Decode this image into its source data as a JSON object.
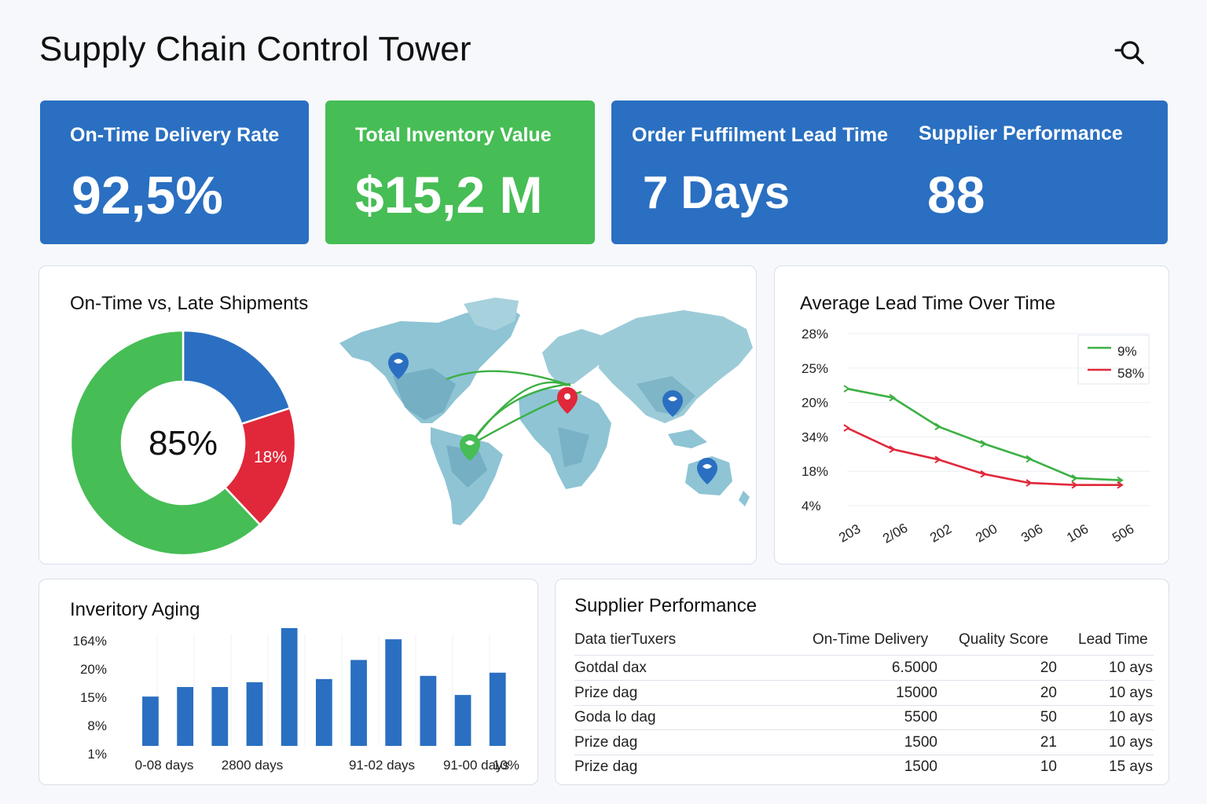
{
  "header": {
    "title": "Supply Chain Control Tower"
  },
  "kpis": {
    "on_time": {
      "label": "On-Time Delivery Rate",
      "value": "92,5%"
    },
    "inventory": {
      "label": "Total Inventory Value",
      "value": "$15,2 M"
    },
    "lead_time": {
      "label": "Order Fuffilment Lead Time",
      "value": "7 Days"
    },
    "supplier": {
      "label": "Supplier Performance",
      "value": "88"
    }
  },
  "shipments": {
    "title": "On-Time vs, Late Shipments",
    "center_label": "85%",
    "late_label": "18%",
    "colors": {
      "on_time": "#46bd55",
      "blue": "#2a6fc1",
      "late": "#e0283a"
    }
  },
  "lead_time_chart": {
    "title": "Average Lead Time Over Time",
    "legend": [
      {
        "label": "9%",
        "color": "#3cb043"
      },
      {
        "label": "58%",
        "color": "#e0283a"
      }
    ]
  },
  "inventory_aging": {
    "title": "Inveritory Aging"
  },
  "supplier_table": {
    "title": "Supplier Performance",
    "columns": [
      "Data tierTuxers",
      "On-Time Delivery",
      "Quality Score",
      "Lead Time"
    ],
    "rows": [
      [
        "Gotdal dax",
        "6.5000",
        "20",
        "10 ays"
      ],
      [
        "Prize dag",
        "15000",
        "20",
        "10 ays"
      ],
      [
        "Goda lo dag",
        "5500",
        "50",
        "10 ays"
      ],
      [
        "Prize dag",
        "1500",
        "21",
        "10 ays"
      ],
      [
        "Prize dag",
        "1500",
        "10",
        "15 ays"
      ]
    ]
  },
  "chart_data": [
    {
      "type": "pie",
      "title": "On-Time vs, Late Shipments",
      "labels": [
        "",
        "18%",
        ""
      ],
      "values": [
        20,
        18,
        62
      ],
      "colors": [
        "#2a6fc1",
        "#e0283a",
        "#46bd55"
      ]
    },
    {
      "type": "line",
      "title": "Average Lead Time Over Time",
      "x": [
        "203",
        "2/06",
        "202",
        "200",
        "306",
        "106",
        "506"
      ],
      "y_ticks": [
        "28%",
        "25%",
        "20%",
        "34%",
        "18%",
        "4%"
      ],
      "series": [
        {
          "name": "9%",
          "color": "#3cb043",
          "values": [
            20,
            18.7,
            14.5,
            12,
            9.8,
            7,
            6.7
          ]
        },
        {
          "name": "58%",
          "color": "#e0283a",
          "values": [
            14.3,
            11.2,
            9.7,
            7.6,
            6.3,
            6,
            6
          ]
        }
      ],
      "y_positions_ticks": [
        28,
        23,
        18,
        13,
        8,
        3
      ],
      "ylim": [
        3,
        28
      ]
    },
    {
      "type": "bar",
      "title": "Inveritory Aging",
      "x_tick_labels": [
        "0-08 days",
        "2800 days",
        "91-02 days",
        "91-00 days",
        "10%"
      ],
      "y_ticks": [
        "164%",
        "20%",
        "15%",
        "8%",
        "1%"
      ],
      "values": [
        31,
        37,
        37,
        40,
        74,
        42,
        54,
        67,
        44,
        32,
        46
      ],
      "ylim": [
        0,
        74
      ],
      "color": "#2a6fc1"
    }
  ]
}
